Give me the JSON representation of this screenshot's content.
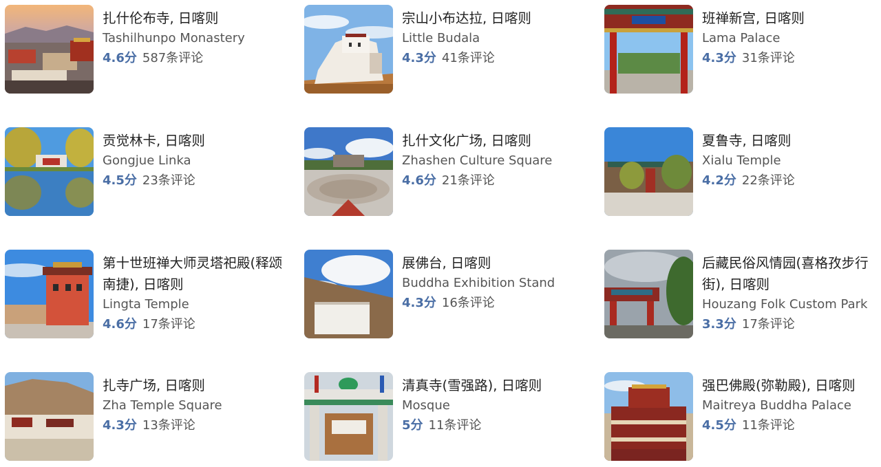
{
  "attractions": [
    {
      "title": "扎什伦布寺, 日喀则",
      "subtitle": "Tashilhunpo Monastery",
      "score": "4.6分",
      "reviews": "587条评论",
      "photo": "tashilhunpo-photo"
    },
    {
      "title": "宗山小布达拉, 日喀则",
      "subtitle": "Little Budala",
      "score": "4.3分",
      "reviews": "41条评论",
      "photo": "little-budala-photo"
    },
    {
      "title": "班禅新宫, 日喀则",
      "subtitle": "Lama Palace",
      "score": "4.3分",
      "reviews": "31条评论",
      "photo": "lama-palace-photo"
    },
    {
      "title": "贡觉林卡, 日喀则",
      "subtitle": "Gongjue Linka",
      "score": "4.5分",
      "reviews": "23条评论",
      "photo": "gongjue-linka-photo"
    },
    {
      "title": "扎什文化广场, 日喀则",
      "subtitle": "Zhashen Culture Square",
      "score": "4.6分",
      "reviews": "21条评论",
      "photo": "culture-square-photo"
    },
    {
      "title": "夏鲁寺, 日喀则",
      "subtitle": "Xialu Temple",
      "score": "4.2分",
      "reviews": "22条评论",
      "photo": "xialu-temple-photo"
    },
    {
      "title": "第十世班禅大师灵塔祀殿(释颂南捷), 日喀则",
      "subtitle": "Lingta Temple",
      "score": "4.6分",
      "reviews": "17条评论",
      "photo": "lingta-temple-photo"
    },
    {
      "title": "展佛台, 日喀则",
      "subtitle": "Buddha Exhibition Stand",
      "score": "4.3分",
      "reviews": "16条评论",
      "photo": "buddha-stand-photo"
    },
    {
      "title": "后藏民俗风情园(喜格孜步行街), 日喀则",
      "subtitle": "Houzang Folk Custom Park",
      "score": "3.3分",
      "reviews": "17条评论",
      "photo": "folk-park-photo"
    },
    {
      "title": "扎寺广场, 日喀则",
      "subtitle": "Zha Temple Square",
      "score": "4.3分",
      "reviews": "13条评论",
      "photo": "zha-square-photo"
    },
    {
      "title": "清真寺(雪强路), 日喀则",
      "subtitle": "Mosque",
      "score": "5分",
      "reviews": "11条评论",
      "photo": "mosque-photo"
    },
    {
      "title": "强巴佛殿(弥勒殿), 日喀则",
      "subtitle": "Maitreya Buddha Palace",
      "score": "4.5分",
      "reviews": "11条评论",
      "photo": "maitreya-palace-photo"
    }
  ],
  "colors": {
    "score": "#4a6ea5",
    "title": "#222222",
    "subtitle": "#555555"
  }
}
